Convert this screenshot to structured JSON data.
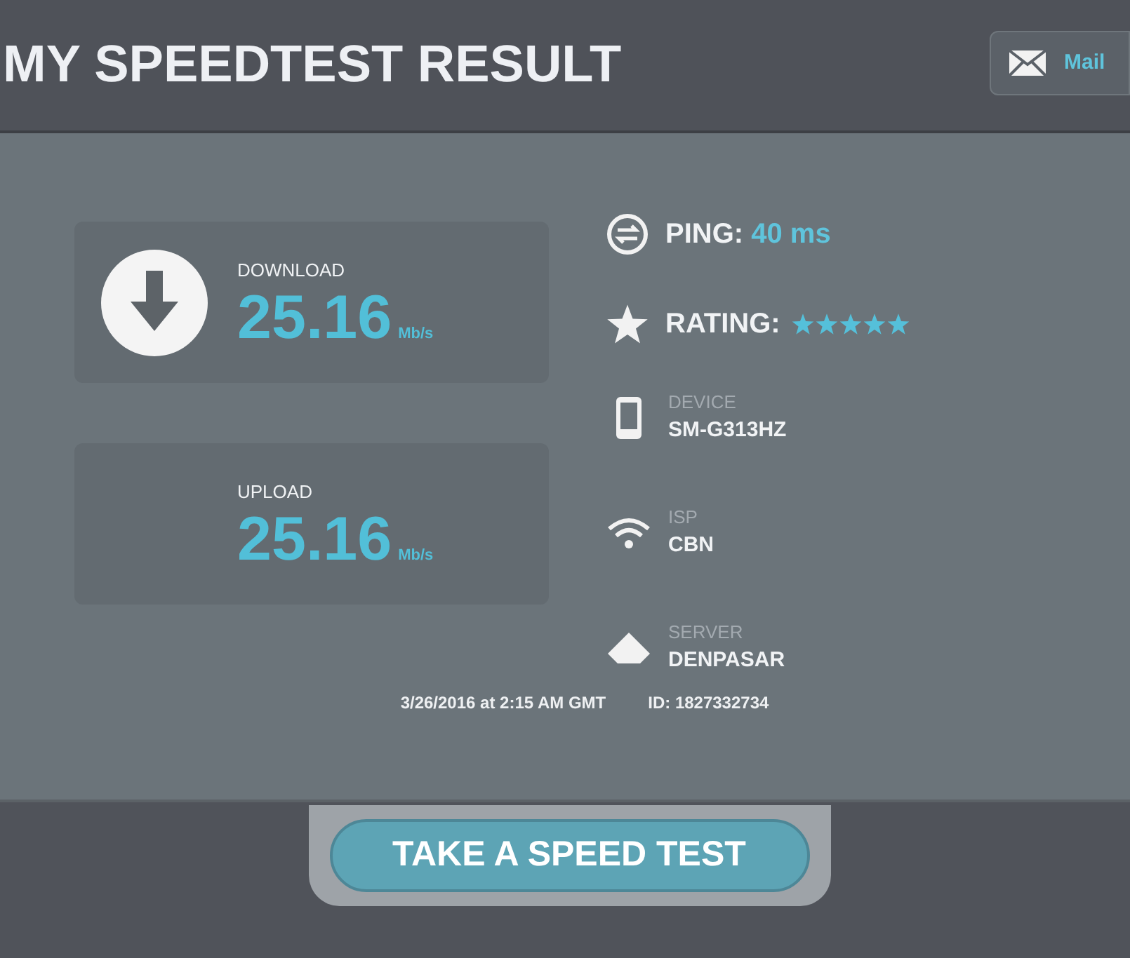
{
  "header": {
    "title": "MY SPEEDTEST RESULT",
    "mail_button": "Mail"
  },
  "speeds": [
    {
      "kind": "download",
      "label": "DOWNLOAD",
      "value": "25.16",
      "unit": "Mb/s"
    },
    {
      "kind": "upload",
      "label": "UPLOAD",
      "value": "25.16",
      "unit": "Mb/s"
    }
  ],
  "ping": {
    "label": "PING:",
    "value": "40 ms"
  },
  "rating": {
    "label": "RATING:",
    "stars": 5
  },
  "details": [
    {
      "kind": "device",
      "label": "DEVICE",
      "value": "SM-G313HZ"
    },
    {
      "kind": "isp",
      "label": "ISP",
      "value": "CBN"
    },
    {
      "kind": "server",
      "label": "SERVER",
      "value": "DENPASAR"
    }
  ],
  "footer": {
    "timestamp": "3/26/2016 at 2:15 AM GMT",
    "id": "ID: 1827332734"
  },
  "action_button": "TAKE A SPEED TEST"
}
